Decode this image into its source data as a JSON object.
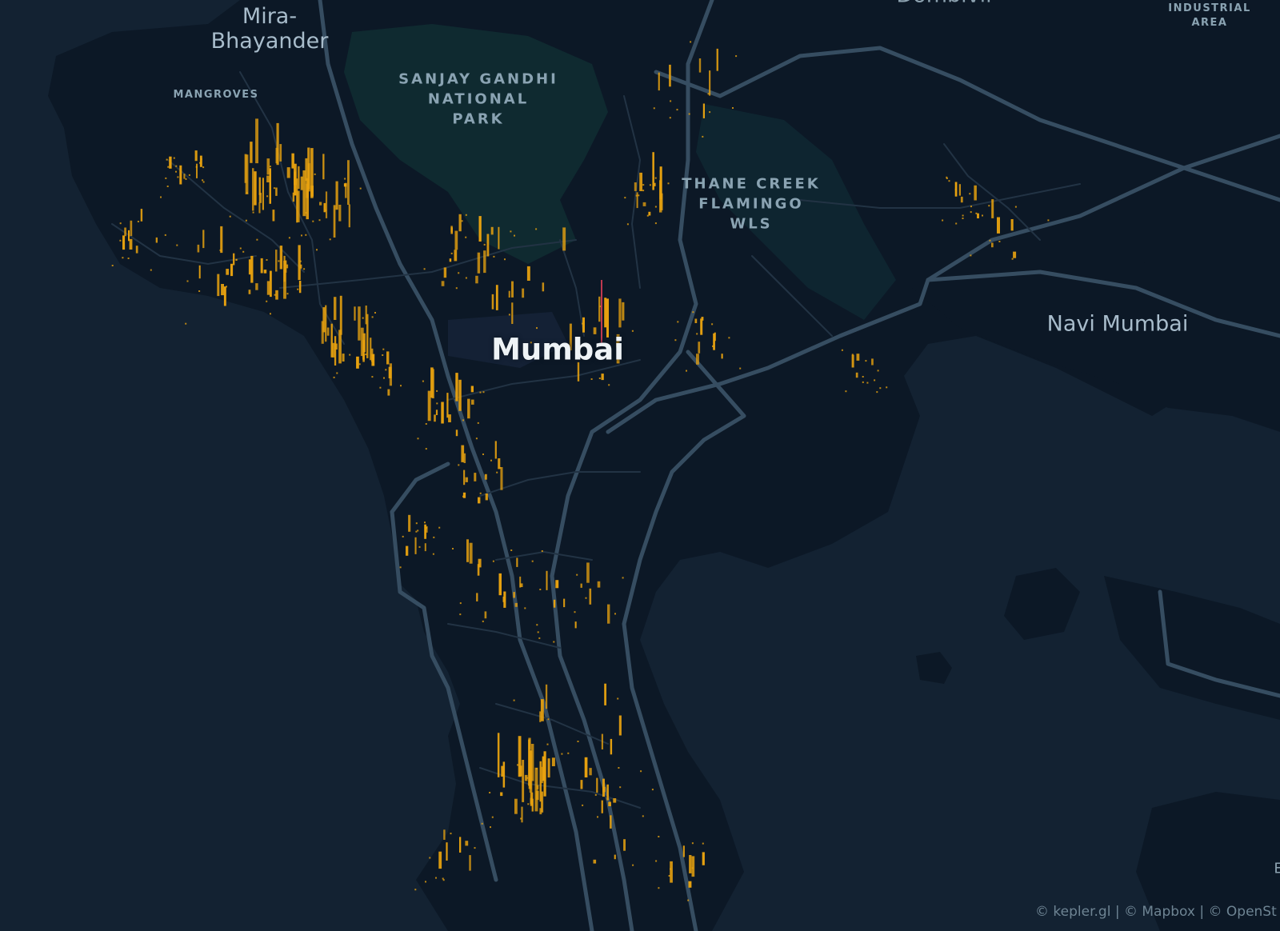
{
  "map": {
    "provider": "kepler.gl",
    "basemap_style": "dark",
    "layer_type": "3d-hexbin-columns",
    "colors": {
      "background_water": "#132232",
      "land": "#0c1826",
      "park": "#0f2a30",
      "road_major": "#364d61",
      "road_minor": "#223344",
      "column_fill": "#e8a20f",
      "column_highlight": "#c0394f"
    }
  },
  "labels": {
    "city_main": "Mumbai",
    "navi_mumbai": "Navi Mumbai",
    "mira_bhayander_line1": "Mira-",
    "mira_bhayander_line2": "Bhayander",
    "sgnp_line1": "SANJAY GANDHI",
    "sgnp_line2": "NATIONAL",
    "sgnp_line3": "PARK",
    "thane_creek_line1": "THANE CREEK",
    "thane_creek_line2": "FLAMINGO",
    "thane_creek_line3": "WLS",
    "mangroves": "MANGROVES",
    "industrial_line1": "INDUSTRIAL",
    "industrial_line2": "AREA",
    "dombivli_partial": "Dombivli",
    "edge_partial": "E"
  },
  "attribution": "© kepler.gl | © Mapbox | © OpenSt"
}
